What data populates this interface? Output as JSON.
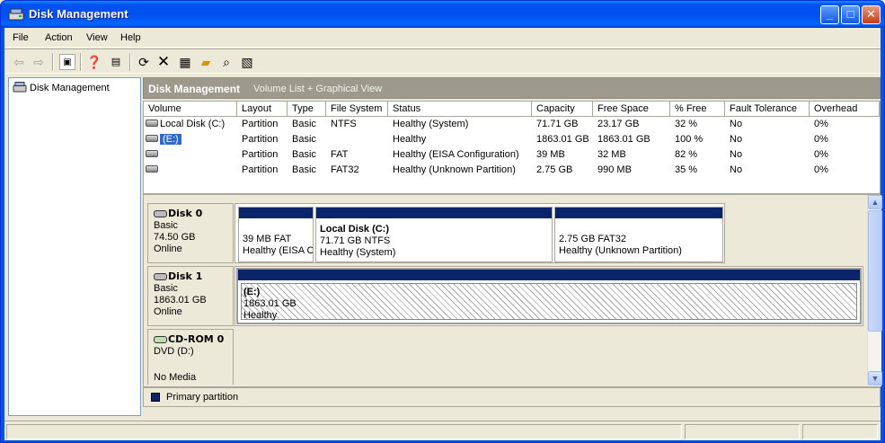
{
  "window": {
    "title": "Disk Management"
  },
  "menu": [
    "File",
    "Action",
    "View",
    "Help"
  ],
  "tree": {
    "root": "Disk Management"
  },
  "header": {
    "title": "Disk Management",
    "subtitle": "Volume List + Graphical View"
  },
  "columns": [
    "Volume",
    "Layout",
    "Type",
    "File System",
    "Status",
    "Capacity",
    "Free Space",
    "% Free",
    "Fault Tolerance",
    "Overhead"
  ],
  "volumes": [
    {
      "volume": "Local Disk (C:)",
      "layout": "Partition",
      "type": "Basic",
      "fs": "NTFS",
      "status": "Healthy (System)",
      "capacity": "71.71 GB",
      "free": "23.17 GB",
      "pct": "32 %",
      "fault": "No",
      "overhead": "0%"
    },
    {
      "volume": "(E:)",
      "layout": "Partition",
      "type": "Basic",
      "fs": "",
      "status": "Healthy",
      "capacity": "1863.01 GB",
      "free": "1863.01 GB",
      "pct": "100 %",
      "fault": "No",
      "overhead": "0%"
    },
    {
      "volume": "",
      "layout": "Partition",
      "type": "Basic",
      "fs": "FAT",
      "status": "Healthy (EISA Configuration)",
      "capacity": "39 MB",
      "free": "32 MB",
      "pct": "82 %",
      "fault": "No",
      "overhead": "0%"
    },
    {
      "volume": "",
      "layout": "Partition",
      "type": "Basic",
      "fs": "FAT32",
      "status": "Healthy (Unknown Partition)",
      "capacity": "2.75 GB",
      "free": "990 MB",
      "pct": "35 %",
      "fault": "No",
      "overhead": "0%"
    }
  ],
  "disks": [
    {
      "name": "Disk 0",
      "kind": "Basic",
      "size": "74.50 GB",
      "state": "Online",
      "partitions": [
        {
          "name": "",
          "line1": "39 MB FAT",
          "line2": "Healthy (EISA C"
        },
        {
          "name": "Local Disk  (C:)",
          "line1": "71.71 GB NTFS",
          "line2": "Healthy (System)"
        },
        {
          "name": "",
          "line1": "2.75 GB FAT32",
          "line2": "Healthy (Unknown Partition)"
        }
      ]
    },
    {
      "name": "Disk 1",
      "kind": "Basic",
      "size": "1863.01 GB",
      "state": "Online",
      "partitions": [
        {
          "name": "(E:)",
          "line1": "1863.01 GB",
          "line2": "Healthy"
        }
      ]
    },
    {
      "name": "CD-ROM 0",
      "kind": "DVD (D:)",
      "size": "",
      "state": "No Media"
    }
  ],
  "legend": {
    "primary": "Primary partition"
  },
  "colors": {
    "title_blue": "#0054e3",
    "partition_bar": "#0a246a",
    "selection": "#316ac5"
  }
}
